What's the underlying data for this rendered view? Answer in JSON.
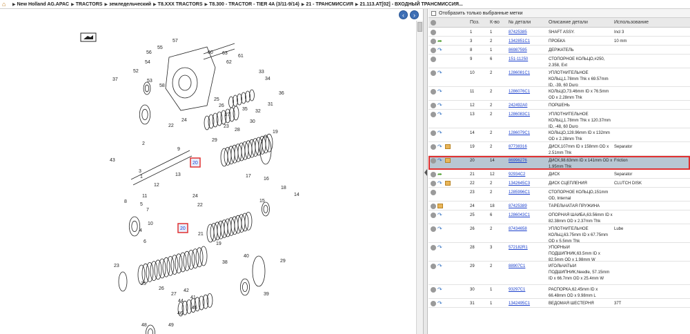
{
  "breadcrumb": {
    "items": [
      "New Holland AG.APAC",
      "TRACTORS",
      "земледельческий",
      "T8.XXX TRACTORS",
      "T8.300 - TRACTOR - TIER 4A (3/11-9/14)",
      "21 - ТРАНСМИССИЯ",
      "21.113.AT[02] - ВХОДНЫЙ ТРАНСМИССИЯ..."
    ]
  },
  "diagram": {
    "callouts": [
      "57",
      "55",
      "56",
      "54",
      "52",
      "53",
      "37",
      "58",
      "62",
      "61",
      "63",
      "60",
      "33",
      "34",
      "36",
      "25",
      "26",
      "27",
      "35",
      "32",
      "31",
      "30",
      "28",
      "24",
      "22",
      "23",
      "29",
      "9",
      "2",
      "1",
      "19",
      "3",
      "43",
      "20",
      "13",
      "12",
      "11",
      "5",
      "8",
      "7",
      "10",
      "4",
      "6",
      "17",
      "18",
      "16",
      "14",
      "15",
      "21",
      "24",
      "22",
      "19",
      "20",
      "39",
      "38",
      "40",
      "41",
      "42",
      "44",
      "45",
      "46",
      "49",
      "48",
      "47",
      "50",
      "23",
      "25",
      "26",
      "27",
      "29"
    ],
    "highlight_labels": [
      "20",
      "20"
    ]
  },
  "filter": {
    "label": "Отобразить только выбранные метки"
  },
  "table": {
    "headers": {
      "pos": "Поз.",
      "qty": "К-во",
      "num": "№ детали",
      "desc": "Описание детали",
      "use": "Использование"
    },
    "rows": [
      {
        "pos": "1",
        "qty": "1",
        "num": "87425385",
        "desc": "SHAFT ASSY.",
        "use": "Incl 3",
        "arrow": "",
        "box": false
      },
      {
        "pos": "3",
        "qty": "2",
        "num": "1342851C1",
        "desc": "ПРОБКА",
        "use": "10 mm",
        "arrow": "green",
        "box": false
      },
      {
        "pos": "8",
        "qty": "1",
        "num": "86987595",
        "desc": "ДЕРЖАТЕЛЬ",
        "use": "",
        "arrow": "blue",
        "box": false
      },
      {
        "pos": "9",
        "qty": "6",
        "num": "151-11250",
        "desc": "СТОПОРНОЕ КОЛЬЦО,#250, 2.358, Ext",
        "use": "",
        "arrow": "",
        "box": false
      },
      {
        "pos": "10",
        "qty": "2",
        "num": "1286081C1",
        "desc": "УПЛОТНИТЕЛЬНОЕ КОЛЬЦ,1.78mm Thk x 69.57mm ID, -39, 60 Duro",
        "use": "",
        "arrow": "blue",
        "box": false
      },
      {
        "pos": "11",
        "qty": "2",
        "num": "1286076C1",
        "desc": "КОЛЬЦО,73.46mm ID x 76.5mm OD x 2.28mm Thk",
        "use": "",
        "arrow": "blue",
        "box": false
      },
      {
        "pos": "12",
        "qty": "2",
        "num": "242492A0",
        "desc": "ПОРШЕНЬ",
        "use": "",
        "arrow": "blue",
        "box": false
      },
      {
        "pos": "13",
        "qty": "2",
        "num": "1286083C1",
        "desc": "УПЛОТНИТЕЛЬНОЕ КОЛЬЦ,1.78mm Thk x 120.37mm ID, -48, 60 Duro",
        "use": "",
        "arrow": "blue",
        "box": false
      },
      {
        "pos": "14",
        "qty": "2",
        "num": "1286079C1",
        "desc": "КОЛЬЦО,128.96mm ID x 132mm OD x 2.28mm Thk",
        "use": "",
        "arrow": "blue",
        "box": false
      },
      {
        "pos": "19",
        "qty": "2",
        "num": "87738316",
        "desc": "ДИСК,107mm ID x 158mm OD x 2.51mm Thk",
        "use": "Separator",
        "arrow": "blue",
        "box": true
      },
      {
        "pos": "20",
        "qty": "14",
        "num": "86996276",
        "desc": "ДИСК,98.63mm ID x 141mm OD x 1.95mm Thk",
        "use": "Friction",
        "arrow": "blue",
        "box": true,
        "selected": true
      },
      {
        "pos": "21",
        "qty": "12",
        "num": "92934C2",
        "desc": "ДИСК",
        "use": "Separator",
        "arrow": "green",
        "box": false
      },
      {
        "pos": "22",
        "qty": "2",
        "num": "1342645C3",
        "desc": "ДИСК СЦЕПЛЕНИЯ",
        "use": "CLUTCH DISK",
        "arrow": "blue",
        "box": true
      },
      {
        "pos": "23",
        "qty": "2",
        "num": "1285996C1",
        "desc": "СТОПОРНОЕ КОЛЬЦО,151mm OD, Internal",
        "use": "",
        "arrow": "",
        "box": false
      },
      {
        "pos": "24",
        "qty": "18",
        "num": "87425389",
        "desc": "ТАРЕЛЬЧАТАЯ ПРУЖИНА",
        "use": "",
        "arrow": "",
        "box": true
      },
      {
        "pos": "25",
        "qty": "6",
        "num": "1286043C1",
        "desc": "ОПОРНАЯ ШАЙБА,63.56mm ID x 82.38mm OD x 2.37mm Thk",
        "use": "",
        "arrow": "blue",
        "box": false
      },
      {
        "pos": "26",
        "qty": "2",
        "num": "87434658",
        "desc": "УПЛОТНИТЕЛЬНОЕ КОЛЬЦ,63.75mm ID x 67.75mm OD x 5.5mm Thk",
        "use": "Lube",
        "arrow": "blue",
        "box": false
      },
      {
        "pos": "28",
        "qty": "3",
        "num": "572182R1",
        "desc": "УПОРНЫЙ ПОДШИПНИК,63.5mm ID x 82.5mm OD x 1.98mm W",
        "use": "",
        "arrow": "blue",
        "box": false
      },
      {
        "pos": "29",
        "qty": "2",
        "num": "88907C1",
        "desc": "ИГОЛЬЧАТЫЙ ПОДШИПНИК,Needle, 57.15mm ID x 66.7mm OD x 25.4mm W",
        "use": "",
        "arrow": "blue",
        "box": false
      },
      {
        "pos": "30",
        "qty": "1",
        "num": "93297C1",
        "desc": "РАСПОРКА,62.45mm ID x 66.48mm OD x 9.98mm L",
        "use": "",
        "arrow": "blue",
        "box": false
      },
      {
        "pos": "31",
        "qty": "1",
        "num": "1342495C1",
        "desc": "ВЕДОМАЯ ШЕСТЕРНЯ",
        "use": "37T",
        "arrow": "blue",
        "box": false
      }
    ]
  },
  "colors": {
    "selected_row": "#b8c7d3",
    "highlight": "#e03030",
    "link": "#1a3fcc",
    "nav": "#3e6fb5"
  }
}
